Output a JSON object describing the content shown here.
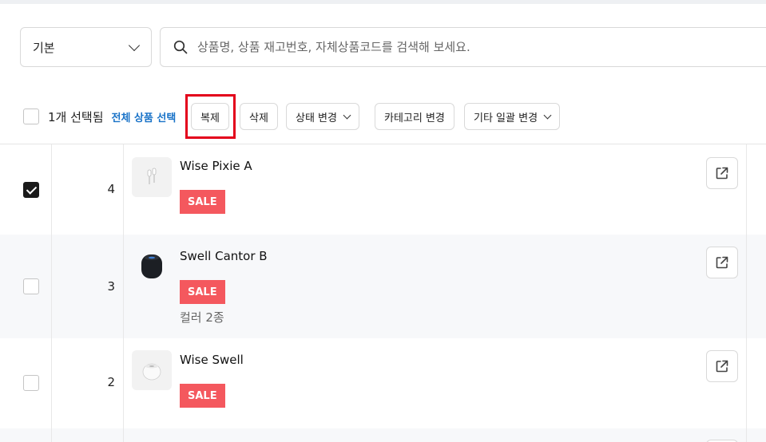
{
  "search": {
    "filter_select": "기본",
    "placeholder": "상품명, 상품 재고번호, 자체상품코드를 검색해 보세요."
  },
  "toolbar": {
    "selected_count": "1개 선택됨",
    "select_all": "전체 상품 선택",
    "duplicate": "복제",
    "delete": "삭제",
    "status_change": "상태 변경",
    "category_change": "카테고리 변경",
    "other_bulk_change": "기타 일괄 변경"
  },
  "products": [
    {
      "checked": true,
      "number": "4",
      "name": "Wise Pixie A",
      "badge": "SALE",
      "sub": "",
      "thumb_icon": "earbuds-icon"
    },
    {
      "checked": false,
      "number": "3",
      "name": "Swell Cantor B",
      "badge": "SALE",
      "sub": "컬러 2종",
      "thumb_icon": "speaker-icon"
    },
    {
      "checked": false,
      "number": "2",
      "name": "Wise Swell",
      "badge": "SALE",
      "sub": "",
      "thumb_icon": "mini-speaker-icon"
    }
  ],
  "colors": {
    "accent": "#1a73c8",
    "sale": "#f4585e",
    "highlight": "#e3001b"
  }
}
